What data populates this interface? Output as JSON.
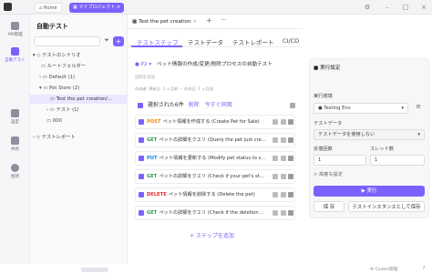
{
  "topbar": {
    "home": "Home",
    "project": "マイプロジェクト"
  },
  "rail": [
    {
      "label": "API管理"
    },
    {
      "label": "自動テスト"
    },
    {
      "label": "設定"
    },
    {
      "label": "共有"
    },
    {
      "label": "招待"
    }
  ],
  "sidebar": {
    "title": "自動テスト",
    "search_placeholder": "",
    "tree": [
      {
        "label": "テストのシナリオ",
        "indent": 0
      },
      {
        "label": "ルートフォルダー",
        "indent": 1
      },
      {
        "label": "Default (1)",
        "indent": 1
      },
      {
        "label": "Pet Store (2)",
        "indent": 1
      },
      {
        "label": "Test the pet creation/...",
        "indent": 2
      },
      {
        "label": "テスト (1)",
        "indent": 2
      },
      {
        "label": "000",
        "indent": 1
      }
    ],
    "report": "テストレポート"
  },
  "doc_tab": {
    "label": "Test the pet creation"
  },
  "main_tabs": [
    "テストステップ",
    "テストデータ",
    "テストレポート",
    "CI/CD"
  ],
  "scenario": {
    "priority": "P2",
    "title": "ペット情報の作成/変更/削除プロセスの自動テスト",
    "desc": "説明を追加",
    "meta": "作成者: 更新日: 1 ヶ月前 ・ 作成日: 1 ヶ月前"
  },
  "selection": {
    "text": "選択された6件",
    "delete": "削除",
    "sync": "今すぐ同期"
  },
  "steps": [
    {
      "method": "POST",
      "color": "#f08c00",
      "desc": "ペット情報を作成する (Create Pet for Sale)"
    },
    {
      "method": "GET",
      "color": "#2f9e44",
      "desc": "ペットの詳細をクエリ (Query the pet just cre..."
    },
    {
      "method": "PUT",
      "color": "#1c7ed6",
      "desc": "ペット情報を更新する (Modify pet status to s..."
    },
    {
      "method": "GET",
      "color": "#2f9e44",
      "desc": "ペットの詳細をクエリ (Check if your pet's st..."
    },
    {
      "method": "DELETE",
      "color": "#e03131",
      "desc": "ペット情報を削除する (Delete the pet)"
    },
    {
      "method": "GET",
      "color": "#2f9e44",
      "desc": "ペットの詳細をクエリ (Check if the deletion ..."
    }
  ],
  "add_step": "+ ステップを追加",
  "run_panel": {
    "title": "実行設定",
    "env_label": "実行環境",
    "env_value": "Testing Env",
    "data_label": "テストデータ",
    "data_value": "テストデータを使用しない",
    "loop_label": "反復回数",
    "loop_value": "1",
    "thread_label": "スレッド数",
    "thread_value": "1",
    "advanced": "> 高度な設定",
    "run": "▶ 実行",
    "save": "保 存",
    "save_instance": "テストインスタンスとして保存"
  },
  "footer": {
    "cookie": "Cookie管理"
  },
  "colors": {
    "accent": "#7b61ff",
    "accent_light": "#efebff"
  }
}
